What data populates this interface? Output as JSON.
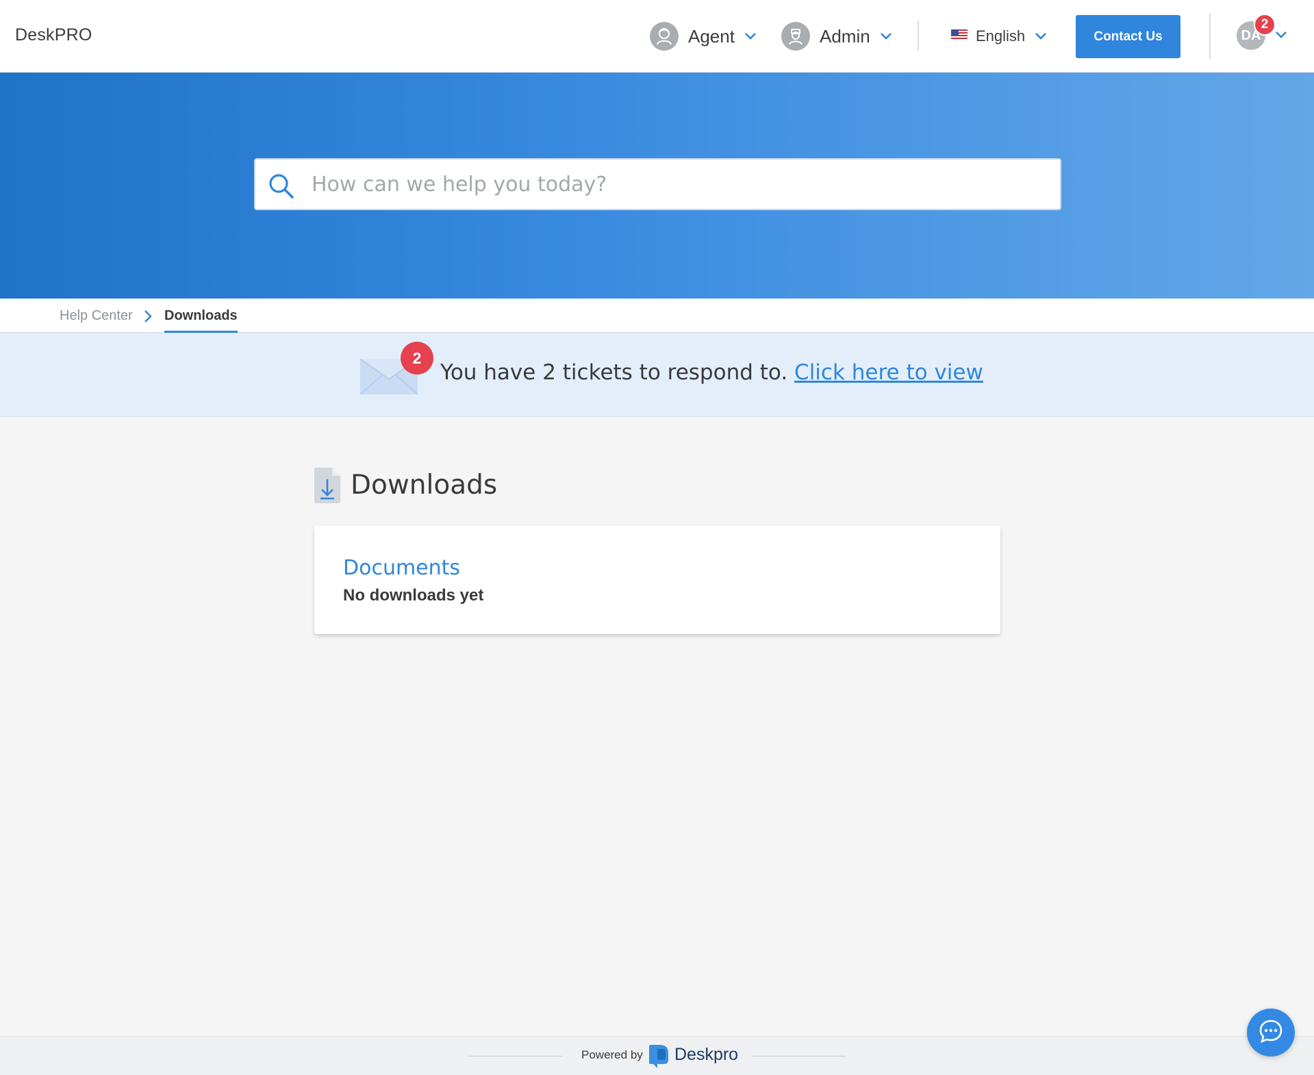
{
  "header": {
    "brand": "DeskPRO",
    "agent_label": "Agent",
    "admin_label": "Admin",
    "language_label": "English",
    "contact_label": "Contact Us",
    "user_initials": "DA",
    "user_badge": "2"
  },
  "search": {
    "placeholder": "How can we help you today?",
    "value": ""
  },
  "breadcrumb": {
    "home": "Help Center",
    "current": "Downloads"
  },
  "notice": {
    "badge": "2",
    "text": "You have 2 tickets to respond to.",
    "link": "Click here to view"
  },
  "main": {
    "title": "Downloads",
    "card": {
      "title": "Documents",
      "subtitle": "No downloads yet"
    }
  },
  "footer": {
    "powered_by": "Powered by",
    "brand": "Deskpro"
  },
  "icons": {
    "agent": "agent-avatar-icon",
    "admin": "admin-avatar-icon",
    "language": "us-flag-icon",
    "search": "search-icon",
    "notice": "envelope-icon",
    "downloads": "download-file-icon",
    "chat": "chat-bubble-icon"
  },
  "colors": {
    "accent": "#2f86dc",
    "badge": "#e5414e",
    "hero_start": "#1f73c8",
    "hero_end": "#63a7e8",
    "notice_bg": "#e3eefa"
  }
}
